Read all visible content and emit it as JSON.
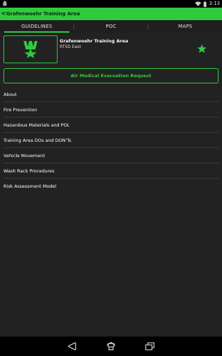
{
  "status_bar": {
    "time": "3:13"
  },
  "action_bar": {
    "title": "Grafenwoehr Training Area",
    "back_glyph": "<"
  },
  "tabs": [
    {
      "label": "GUIDELINES",
      "active": true
    },
    {
      "label": "POC",
      "active": false
    },
    {
      "label": "MAPS",
      "active": false
    }
  ],
  "header": {
    "name": "Grafenwoehr Training Area",
    "subtitle": "RTSD East",
    "favorite": true
  },
  "medevac_button": {
    "label": "Air Medical Evacuation Request"
  },
  "guidelines": [
    {
      "label": "About"
    },
    {
      "label": "Fire Prevention"
    },
    {
      "label": "Hazardous Materials and POL"
    },
    {
      "label": "Training Area DOs and DON'Ts"
    },
    {
      "label": "Vehicle Movement"
    },
    {
      "label": "Wash Rack Procedures"
    },
    {
      "label": "Risk Assessment Model"
    }
  ],
  "colors": {
    "accent": "#2fcb3f",
    "background": "#222222",
    "action_bar_text": "#0d2a0f"
  },
  "icons": [
    "android-icon",
    "wifi-icon",
    "battery-icon",
    "back-arrow-icon",
    "unit-insignia-icon",
    "star-icon",
    "nav-back-icon",
    "nav-home-icon",
    "nav-recents-icon"
  ]
}
